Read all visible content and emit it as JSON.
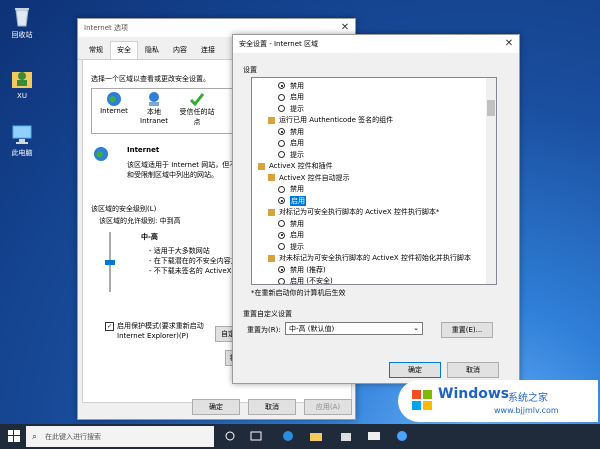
{
  "desktop": {
    "icons": [
      {
        "label": "回收站"
      },
      {
        "label": "XU"
      },
      {
        "label": "此电脑"
      }
    ]
  },
  "inet": {
    "title": "Internet 选项",
    "tabs": [
      "常规",
      "安全",
      "隐私",
      "内容",
      "连接"
    ],
    "zone_prompt": "选择一个区域以查看或更改安全设置。",
    "zones": [
      {
        "label": "Internet"
      },
      {
        "label": "本地\nIntranet"
      },
      {
        "label": "受信任的站\n点"
      }
    ],
    "zone_title": "Internet",
    "zone_desc": "该区域适用于 Internet 网站，但不\n和受限制区域中列出的网站。",
    "level_group": "该区域的安全级别(L)",
    "level_allowed": "该区域的允许级别: 中到高",
    "level_name": "中-高",
    "level_bullets": [
      "- 适用于大多数网站",
      "- 在下载潜在的不安全内容之",
      "- 不下载未签名的 ActiveX 控"
    ],
    "protected_mode": "启用保护模式(要求重新启动\nInternet Explorer)(P)",
    "custom_btn": "自定",
    "default_btn": "将",
    "ok": "确定",
    "cancel": "取消",
    "apply": "应用(A)"
  },
  "sec": {
    "title": "安全设置 - Internet 区域",
    "settings_label": "设置",
    "rows": [
      {
        "type": "radio",
        "text": "禁用",
        "on": true,
        "indent": 2
      },
      {
        "type": "radio",
        "text": "启用",
        "on": false,
        "indent": 2
      },
      {
        "type": "radio",
        "text": "提示",
        "on": false,
        "indent": 2
      },
      {
        "type": "head",
        "text": "运行已用 Authenticode 签名的组件",
        "indent": 1
      },
      {
        "type": "radio",
        "text": "禁用",
        "on": true,
        "indent": 2
      },
      {
        "type": "radio",
        "text": "启用",
        "on": false,
        "indent": 2
      },
      {
        "type": "radio",
        "text": "提示",
        "on": false,
        "indent": 2
      },
      {
        "type": "head",
        "text": "ActiveX 控件和插件",
        "indent": 0
      },
      {
        "type": "head",
        "text": "ActiveX 控件自动提示",
        "indent": 1
      },
      {
        "type": "radio",
        "text": "禁用",
        "on": false,
        "indent": 2
      },
      {
        "type": "radio",
        "text": "启用",
        "on": true,
        "indent": 2,
        "selected": true
      },
      {
        "type": "head",
        "text": "对标记为可安全执行脚本的 ActiveX 控件执行脚本*",
        "indent": 1
      },
      {
        "type": "radio",
        "text": "禁用",
        "on": false,
        "indent": 2
      },
      {
        "type": "radio",
        "text": "启用",
        "on": true,
        "indent": 2
      },
      {
        "type": "radio",
        "text": "提示",
        "on": false,
        "indent": 2
      },
      {
        "type": "head",
        "text": "对未标记为可安全执行脚本的 ActiveX 控件初始化并执行脚本",
        "indent": 1
      },
      {
        "type": "radio",
        "text": "禁用 (推荐)",
        "on": true,
        "indent": 2
      },
      {
        "type": "radio",
        "text": "启用 (不安全)",
        "on": false,
        "indent": 2
      }
    ],
    "restart_note": "*在重新启动你的计算机后生效",
    "reset_group": "重置自定义设置",
    "reset_to_label": "重置为(R):",
    "reset_value": "中-高 (默认值)",
    "reset_btn": "重置(E)...",
    "ok": "确定",
    "cancel": "取消"
  },
  "taskbar": {
    "search_placeholder": "在此键入进行搜索"
  },
  "watermark": {
    "brand": "Windows",
    "suffix": "系统之家",
    "url": "www.bjjmlv.com"
  }
}
